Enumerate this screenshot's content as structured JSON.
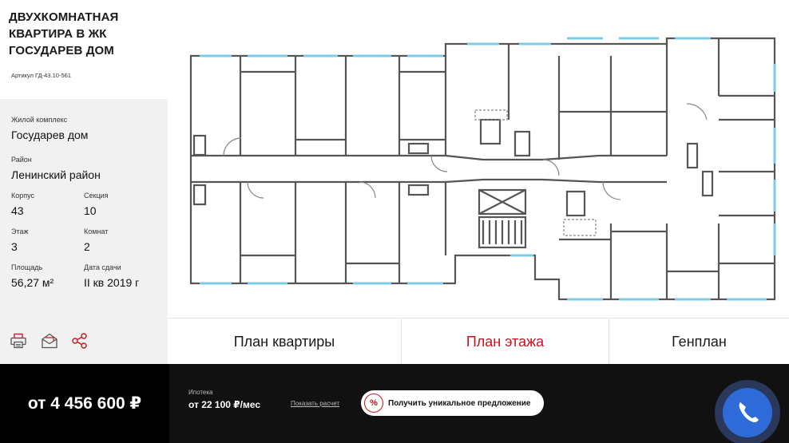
{
  "title": "Двухкомнатная квартира в ЖК Государев дом",
  "article": "Артикул ГД-43.10-561",
  "info": {
    "complex_label": "Жилой комплекс",
    "complex": "Государев дом",
    "district_label": "Район",
    "district": "Ленинский район",
    "building_label": "Корпус",
    "building": "43",
    "section_label": "Секция",
    "section": "10",
    "floor_label": "Этаж",
    "floor": "3",
    "rooms_label": "Комнат",
    "rooms": "2",
    "area_label": "Площадь",
    "area": "56,27 м²",
    "delivery_label": "Дата сдачи",
    "delivery": "II кв 2019 г"
  },
  "tabs": [
    {
      "label": "План квартиры",
      "active": false
    },
    {
      "label": "План этажа",
      "active": true
    },
    {
      "label": "Генплан",
      "active": false
    }
  ],
  "bottom": {
    "price": "от 4 456 600 ₽",
    "mortgage_label": "Ипотека",
    "mortgage_value": "от 22 100 ₽/мес",
    "calc_link": "Показать расчет",
    "offer_button": "Получить уникальное предложение",
    "offer_icon": "%"
  },
  "icons": {
    "print": "print-icon",
    "email": "email-icon",
    "share": "share-icon",
    "phone": "phone-icon"
  },
  "colors": {
    "accent": "#c4161c",
    "panel": "#f1f1f1",
    "bottom_bar": "#111111",
    "call": "#2f6bd8",
    "window": "#7ecbe6"
  }
}
